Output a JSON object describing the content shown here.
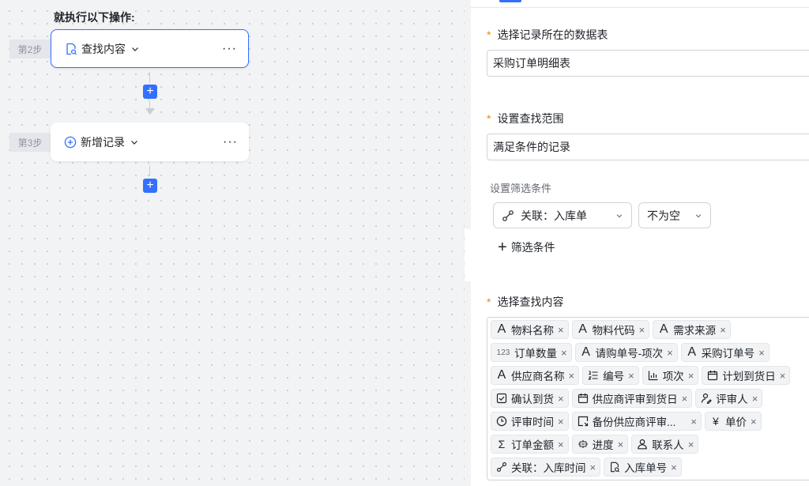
{
  "flow": {
    "title": "就执行以下操作:",
    "steps": [
      {
        "tag": "第2步",
        "label": "查找内容"
      },
      {
        "tag": "第3步",
        "label": "新增记录"
      }
    ],
    "add_symbol": "+",
    "more_symbol": "···"
  },
  "panel": {
    "table_label": "选择记录所在的数据表",
    "table_value": "采购订单明细表",
    "range_label": "设置查找范围",
    "range_value": "满足条件的记录",
    "filter_label": "设置筛选条件",
    "condition_field": "关联：入库单",
    "condition_operator": "不为空",
    "add_condition": "筛选条件",
    "content_label": "选择查找内容",
    "required_mark": "*",
    "tags": [
      [
        "物料名称",
        "物料代码",
        "需求来源"
      ],
      [
        "订单数量",
        "请购单号-项次",
        "采购订单号"
      ],
      [
        "供应商名称",
        "编号",
        "项次",
        "计划到货日"
      ],
      [
        "确认到货",
        "供应商评审到货日",
        "评审人"
      ],
      [
        "评审时间",
        "备份供应商评审...",
        "单价"
      ],
      [
        "订单金额",
        "进度",
        "联系人"
      ],
      [
        "关联：入库时间",
        "入库单号"
      ]
    ],
    "number_icon_text": "123",
    "currency_icon": "¥",
    "sum_icon": "Σ",
    "text_icon": "A",
    "remove_symbol": "×"
  },
  "colors": {
    "accent": "#3370ff",
    "required": "#e58a17"
  }
}
